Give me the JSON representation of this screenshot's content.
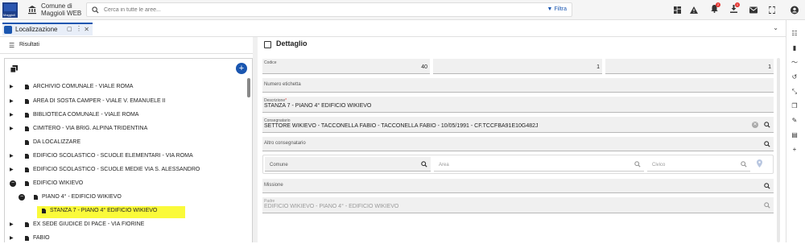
{
  "app": {
    "logo_caption": "Maggioli",
    "name_line1": "Comune di",
    "name_line2": "Maggioli WEB"
  },
  "search": {
    "placeholder": "Cerca in tutte le aree...",
    "filter_label": "Filtra"
  },
  "toolbar": {
    "icons": [
      "dashboard-icon",
      "warning-icon",
      "bell-icon",
      "download-icon",
      "mail-icon",
      "fullscreen-icon",
      "account-icon"
    ],
    "badges": {
      "bell": "2",
      "download": "1"
    }
  },
  "tab": {
    "label": "Localizzazione"
  },
  "left": {
    "header": "Risultati",
    "tree": [
      {
        "label": "ARCHIVIO COMUNALE - VIALE ROMA",
        "level": 0,
        "expander": "collapsed"
      },
      {
        "label": "AREA DI SOSTA CAMPER - VIALE V. EMANUELE II",
        "level": 0,
        "expander": "collapsed"
      },
      {
        "label": "BIBLIOTECA COMUNALE - VIALE ROMA",
        "level": 0,
        "expander": "collapsed"
      },
      {
        "label": "CIMITERO - VIA BRIG. ALPINA TRIDENTINA",
        "level": 0,
        "expander": "collapsed"
      },
      {
        "label": "DA LOCALIZZARE",
        "level": 0,
        "expander": "none"
      },
      {
        "label": "EDIFICIO SCOLASTICO - SCUOLE ELEMENTARI - VIA ROMA",
        "level": 0,
        "expander": "collapsed"
      },
      {
        "label": "EDIFICIO SCOLASTICO - SCUOLE MEDIE VIA S. ALESSANDRO",
        "level": 0,
        "expander": "collapsed"
      },
      {
        "label": "EDIFICIO WIKIEVO",
        "level": 0,
        "expander": "expanded"
      },
      {
        "label": "PIANO 4° - EDIFICIO WIKIEVO",
        "level": 1,
        "expander": "expanded"
      },
      {
        "label": "STANZA 7 - PIANO 4° EDIFICIO WIKIEVO",
        "level": 2,
        "expander": "none",
        "selected": true
      },
      {
        "label": "EX SEDE GIUDICE DI PACE - VIA FIORINE",
        "level": 0,
        "expander": "collapsed"
      },
      {
        "label": "FABIO",
        "level": 0,
        "expander": "collapsed"
      }
    ]
  },
  "detail": {
    "header": "Dettaglio",
    "codice_label": "Codice",
    "codice_1": "40",
    "codice_2": "1",
    "codice_3": "1",
    "numero_etichetta_label": "Numero etichetta",
    "numero_etichetta": "",
    "descrizione_label": "Descrizione",
    "descrizione": "STANZA 7 - PIANO 4° EDIFICIO WIKIEVO",
    "consegnatario_label": "Consegnatario",
    "consegnatario": "SETTORE WIKIEVO - TACCONELLA FABIO - TACCONELLA FABIO - 10/05/1991 - CF.TCCFBA91E10G482J",
    "altro_label": "Altro consegnatario",
    "comune_label": "Comune",
    "area_label": "Area",
    "civico_label": "Civico",
    "missione_label": "Missione",
    "padre_label": "Padre",
    "padre": "EDIFICIO WIKIEVO - PIANO 4° - EDIFICIO WIKIEVO"
  }
}
